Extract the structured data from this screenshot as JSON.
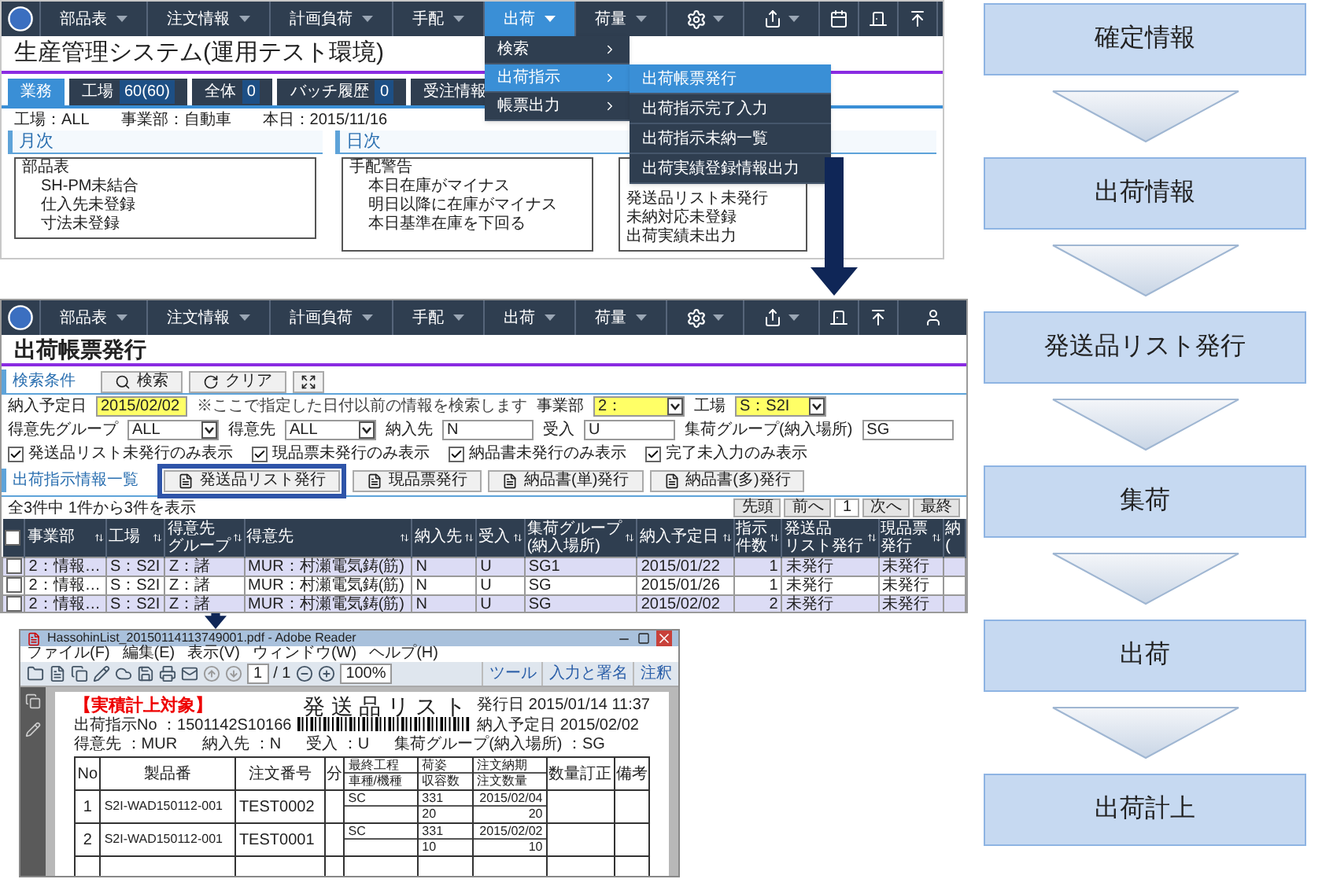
{
  "top_screen": {
    "nav": [
      {
        "label": "部品表",
        "selected": false
      },
      {
        "label": "注文情報",
        "selected": false
      },
      {
        "label": "計画負荷",
        "selected": false
      },
      {
        "label": "手配",
        "selected": false
      },
      {
        "label": "出荷",
        "selected": true
      },
      {
        "label": "荷量",
        "selected": false
      }
    ],
    "title": "生産管理システム(運用テスト環境)",
    "tabs": [
      {
        "label": "業務",
        "selected": true
      },
      {
        "label": "工場",
        "count": "60(60)",
        "selected": false
      },
      {
        "label": "全体",
        "count": "0",
        "selected": false
      },
      {
        "label": "バッチ履歴",
        "count": "0",
        "selected": false
      },
      {
        "label": "受注情報",
        "selected": false
      }
    ],
    "info": [
      "工場：ALL",
      "事業部：自動車",
      "本日：2015/11/16"
    ],
    "sections": [
      {
        "title": "月次",
        "boxes": [
          {
            "title": "部品表",
            "items": [
              "SH-PM未結合",
              "仕入先未登録",
              "寸法未登録"
            ]
          }
        ]
      },
      {
        "title": "日次",
        "boxes": [
          {
            "title": "手配警告",
            "items": [
              "本日在庫がマイナス",
              "明日以降に在庫がマイナス",
              "本日基準在庫を下回る"
            ]
          },
          {
            "items": [
              "発送品リスト未発行",
              "未納対応未登録",
              "出荷実績未出力"
            ]
          }
        ]
      }
    ],
    "menu": [
      {
        "label": "検索",
        "selected": false
      },
      {
        "label": "出荷指示",
        "selected": true
      },
      {
        "label": "帳票出力",
        "selected": false
      }
    ],
    "submenu": [
      {
        "label": "出荷帳票発行",
        "selected": true
      },
      {
        "label": "出荷指示完了入力",
        "selected": false
      },
      {
        "label": "出荷指示未納一覧",
        "selected": false
      },
      {
        "label": "出荷実績登録情報出力",
        "selected": false
      }
    ]
  },
  "middle_screen": {
    "nav": [
      {
        "label": "部品表",
        "selected": false
      },
      {
        "label": "注文情報",
        "selected": false
      },
      {
        "label": "計画負荷",
        "selected": false
      },
      {
        "label": "手配",
        "selected": false
      },
      {
        "label": "出荷",
        "selected": false
      },
      {
        "label": "荷量",
        "selected": false
      }
    ],
    "title": "出荷帳票発行",
    "search_title": "検索条件",
    "search_buttons": [
      "検索",
      "クリア"
    ],
    "form_rows": [
      [
        {
          "kind": "label",
          "text": "納入予定日"
        },
        {
          "kind": "input",
          "value": "2015/02/02",
          "highlighted": true
        },
        {
          "kind": "note",
          "text": "※ここで指定した日付以前の情報を検索します"
        },
        {
          "kind": "label",
          "text": "事業部"
        },
        {
          "kind": "select",
          "value": "2：",
          "highlighted": true
        },
        {
          "kind": "label",
          "text": "工場"
        },
        {
          "kind": "select",
          "value": "S：S2I",
          "highlighted": true
        }
      ],
      [
        {
          "kind": "label",
          "text": "得意先グループ"
        },
        {
          "kind": "select",
          "value": "ALL",
          "highlighted": false
        },
        {
          "kind": "label",
          "text": "得意先"
        },
        {
          "kind": "select",
          "value": "ALL",
          "highlighted": false
        },
        {
          "kind": "label",
          "text": "納入先"
        },
        {
          "kind": "input",
          "value": "N",
          "highlighted": false
        },
        {
          "kind": "label",
          "text": "受入"
        },
        {
          "kind": "input",
          "value": "U",
          "highlighted": false
        },
        {
          "kind": "label",
          "text": "集荷グループ(納入場所)"
        },
        {
          "kind": "input",
          "value": "SG",
          "highlighted": false
        }
      ]
    ],
    "checkboxes": [
      {
        "label": "発送品リスト未発行のみ表示",
        "checked": true
      },
      {
        "label": "現品票未発行のみ表示",
        "checked": true
      },
      {
        "label": "納品書未発行のみ表示",
        "checked": true
      },
      {
        "label": "完了未入力のみ表示",
        "checked": true
      }
    ],
    "list_title": "出荷指示情報一覧",
    "list_buttons": [
      {
        "label": "発送品リスト発行",
        "highlighted": true
      },
      {
        "label": "現品票発行",
        "highlighted": false
      },
      {
        "label": "納品書(単)発行",
        "highlighted": false
      },
      {
        "label": "納品書(多)発行",
        "highlighted": false
      }
    ],
    "count": "全3件中 1件から3件を表示",
    "pager": [
      {
        "label": "先頭",
        "selected": false
      },
      {
        "label": "前へ",
        "selected": false
      },
      {
        "label": "1",
        "selected": true
      },
      {
        "label": "次へ",
        "selected": false
      },
      {
        "label": "最終",
        "selected": false
      }
    ],
    "header_checked": false,
    "columns": [
      {
        "lines": [
          "事業部"
        ]
      },
      {
        "lines": [
          "工場"
        ]
      },
      {
        "lines": [
          "得意先",
          "グループ"
        ]
      },
      {
        "lines": [
          "得意先"
        ]
      },
      {
        "lines": [
          "納入先"
        ]
      },
      {
        "lines": [
          "受入"
        ]
      },
      {
        "lines": [
          "集荷グループ",
          "(納入場所)"
        ]
      },
      {
        "lines": [
          "納入予定日"
        ]
      },
      {
        "lines": [
          "指示",
          "件数"
        ]
      },
      {
        "lines": [
          "発送品",
          "リスト発行"
        ]
      },
      {
        "lines": [
          "現品票",
          "発行"
        ]
      },
      {
        "lines": [
          "納",
          "("
        ]
      }
    ],
    "rows": [
      {
        "checked": false,
        "cells": [
          "2：情報…",
          "S：S2I",
          "Z：諸",
          "MUR：村瀬電気鋳(筋)",
          "N",
          "U",
          "SG1",
          "2015/01/22",
          "1",
          "未発行",
          "未発行"
        ]
      },
      {
        "checked": false,
        "cells": [
          "2：情報…",
          "S：S2I",
          "Z：諸",
          "MUR：村瀬電気鋳(筋)",
          "N",
          "U",
          "SG",
          "2015/01/26",
          "1",
          "未発行",
          "未発行"
        ]
      },
      {
        "checked": false,
        "cells": [
          "2：情報…",
          "S：S2I",
          "Z：諸",
          "MUR：村瀬電気鋳(筋)",
          "N",
          "U",
          "SG",
          "2015/02/02",
          "2",
          "未発行",
          "未発行"
        ]
      }
    ]
  },
  "pdf_window": {
    "title": "HassohinList_20150114113749001.pdf - Adobe Reader",
    "menu": [
      "ファイル(F)",
      "編集(E)",
      "表示(V)",
      "ウィンドウ(W)",
      "ヘルプ(H)"
    ],
    "page": "1",
    "page_total": "/ 1",
    "zoom": "100%",
    "links": [
      "ツール",
      "入力と署名",
      "注釈"
    ],
    "document": {
      "tag": "【実積計上対象】",
      "title": "発 送 品 リ ス ト",
      "issued": "発行日 2015/01/14 11:37",
      "instruction_no": "出荷指示No ：1501142S10166",
      "due": "納入予定日 2015/02/02",
      "fields": [
        "得意先 ：MUR",
        "納入先 ：N",
        "受入 ：U",
        "集荷グループ(納入場所) ：SG"
      ],
      "columns": {
        "no": "No",
        "product": "製品番",
        "order": "注文番号",
        "div": "分",
        "process": [
          "最終工程",
          "車種/機種"
        ],
        "packing": [
          "荷姿",
          "収容数"
        ],
        "due": [
          "注文納期",
          "注文数量"
        ],
        "correction": "数量訂正",
        "remarks": "備考"
      },
      "rows": [
        {
          "no": "1",
          "product": "S2I-WAD150112-001",
          "order": "TEST0002",
          "process": "SC",
          "packing": "331",
          "per_pack": "20",
          "due": "2015/02/04",
          "quantity": "20"
        },
        {
          "no": "2",
          "product": "S2I-WAD150112-001",
          "order": "TEST0001",
          "process": "SC",
          "packing": "331",
          "per_pack": "10",
          "due": "2015/02/02",
          "quantity": "10"
        }
      ]
    }
  },
  "flow": [
    "確定情報",
    "出荷情報",
    "発送品リスト発行",
    "集荷",
    "出荷",
    "出荷計上"
  ]
}
